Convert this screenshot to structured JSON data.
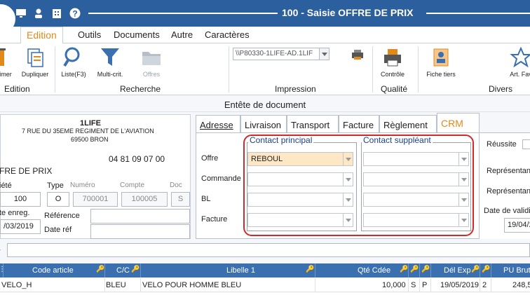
{
  "window": {
    "title": "100 - Saisie OFFRE DE PRIX"
  },
  "menu": {
    "items": [
      "Edition",
      "Outils",
      "Documents",
      "Autre",
      "Caractères"
    ]
  },
  "ribbon": {
    "edition": {
      "label": "Edition",
      "buttons": [
        "imer",
        "Dupliquer"
      ]
    },
    "recherche": {
      "label": "Recherche",
      "buttons": [
        "Liste(F3)",
        "Multi-crit.",
        "Offres"
      ]
    },
    "impression": {
      "label": "Impression",
      "printer": "\\\\P80330-1LIFE-AD.1LIF"
    },
    "qualite": {
      "label": "Qualité",
      "buttons": [
        "Contrôle"
      ]
    },
    "divers": {
      "label": "Divers",
      "buttons": [
        "Fiche tiers",
        "Art. Fav"
      ]
    }
  },
  "section": {
    "title": "Entête de document"
  },
  "company": {
    "name": "1LIFE",
    "address": "7 RUE DU 35EME REGIMENT DE L'AVIATION",
    "city": "69500 BRON",
    "phone": "04 81 09 07 00",
    "doc_type": "FRE DE PRIX"
  },
  "header_fields": {
    "societe_label": "iété",
    "societe_value": "100",
    "type_label": "Type",
    "type_value": "O",
    "numero_label": "Numéro",
    "numero_value": "700001",
    "compte_label": "Compte",
    "compte_value": "100005",
    "doc_label": "Doc",
    "doc_value": "S",
    "date_label": "te enreg.",
    "date_value": "/03/2019",
    "reference_label": "Référence",
    "reference_value": "",
    "dateref_label": "Date réf",
    "dateref_value": ""
  },
  "tabs": [
    {
      "label": "Adresse",
      "active": false
    },
    {
      "label": "Livraison",
      "active": false
    },
    {
      "label": "Transport",
      "active": false
    },
    {
      "label": "Facture",
      "active": false
    },
    {
      "label": "Règlement",
      "active": false
    },
    {
      "label": "CRM",
      "active": true
    }
  ],
  "crm": {
    "principal_title": "Contact principal",
    "suppleant_title": "Contact suppléant",
    "rows": [
      {
        "label": "Offre",
        "principal": "REBOUL",
        "suppleant": ""
      },
      {
        "label": "Commande",
        "principal": "",
        "suppleant": ""
      },
      {
        "label": "BL",
        "principal": "",
        "suppleant": ""
      },
      {
        "label": "Facture",
        "principal": "",
        "suppleant": ""
      }
    ],
    "right": {
      "reussite": "Réussite",
      "rep1": "Représentan",
      "rep2": "Représentan",
      "date_label": "Date de validi",
      "date_value": "19/04/2"
    }
  },
  "grid": {
    "headers": [
      "Code article",
      "C/C",
      "Libelle 1",
      "Qté Cdée",
      "Dél Exp",
      "PU Brut"
    ],
    "rows": [
      {
        "code": "VELO_H",
        "cc": "BLEU",
        "libelle": "VELO POUR HOMME BLEU",
        "qte": "10,000",
        "s": "S",
        "p": "P",
        "date": "19/05/2019",
        "n": "2",
        "pu": "248,5"
      }
    ]
  },
  "colors": {
    "titlebar": "#2b5f9e",
    "accent": "#e08a1a",
    "grid_header": "#3a6fb0",
    "highlight": "#d12a2a",
    "group_title": "#1e3f8a"
  }
}
